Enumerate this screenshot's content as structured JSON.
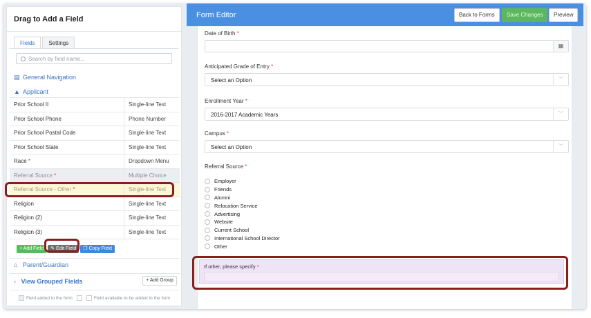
{
  "left_panel": {
    "title": "Drag to Add a Field",
    "tabs": [
      "Fields",
      "Settings"
    ],
    "search_placeholder": "Search by field name...",
    "sections": {
      "general_navigation": "General Navigation",
      "applicant": "Applicant",
      "parent_guardian": "Parent/Guardian"
    },
    "fields": [
      {
        "name": "Prior School II",
        "type": "Single-line Text",
        "required": false,
        "state": "normal"
      },
      {
        "name": "Prior School Phone",
        "type": "Phone Number",
        "required": false,
        "state": "normal"
      },
      {
        "name": "Prior School Postal Code",
        "type": "Single-line Text",
        "required": false,
        "state": "normal"
      },
      {
        "name": "Prior School State",
        "type": "Single-line Text",
        "required": false,
        "state": "normal"
      },
      {
        "name": "Race",
        "type": "Dropdown Menu",
        "required": true,
        "state": "normal"
      },
      {
        "name": "Referral Source",
        "type": "Multiple Choice",
        "required": true,
        "state": "added"
      },
      {
        "name": "Referral Source - Other",
        "type": "Single-line Text",
        "required": true,
        "state": "selected"
      },
      {
        "name": "Religion",
        "type": "Single-line Text",
        "required": false,
        "state": "normal"
      },
      {
        "name": "Religion (2)",
        "type": "Single-line Text",
        "required": false,
        "state": "normal"
      },
      {
        "name": "Religion (3)",
        "type": "Single-line Text",
        "required": false,
        "state": "normal"
      }
    ],
    "actions": {
      "add_field": "+ Add Field",
      "edit_field": "Edit Field",
      "copy_field": "Copy Field"
    },
    "view_grouped_fields": "View Grouped Fields",
    "add_group": "Add Group",
    "legend": {
      "added": "Field added to the form",
      "available": "Field available to be added to the form"
    }
  },
  "editor": {
    "title": "Form Editor",
    "back_button": "Back to Forms",
    "save_button": "Save Changes",
    "preview_button": "Preview",
    "fields": {
      "dob_label": "Date of Birth",
      "grade_label": "Anticipated Grade of Entry",
      "grade_value": "Select an Option",
      "year_label": "Enrollment Year",
      "year_value": "2016-2017 Academic Years",
      "campus_label": "Campus",
      "campus_value": "Select an Option",
      "referral_label": "Referral Source",
      "referral_options": [
        "Employer",
        "Friends",
        "Alumni",
        "Relocation Service",
        "Advertising",
        "Website",
        "Current School",
        "International School Director",
        "Other"
      ],
      "specify_label": "If other, please specify"
    }
  },
  "colors": {
    "accent": "#4a90e2",
    "save_green": "#5cb85c",
    "required": "#dd3333",
    "annotation": "#8c1d1d",
    "highlight_row": "#fbf7d7",
    "highlight_field": "#efe3f6"
  }
}
